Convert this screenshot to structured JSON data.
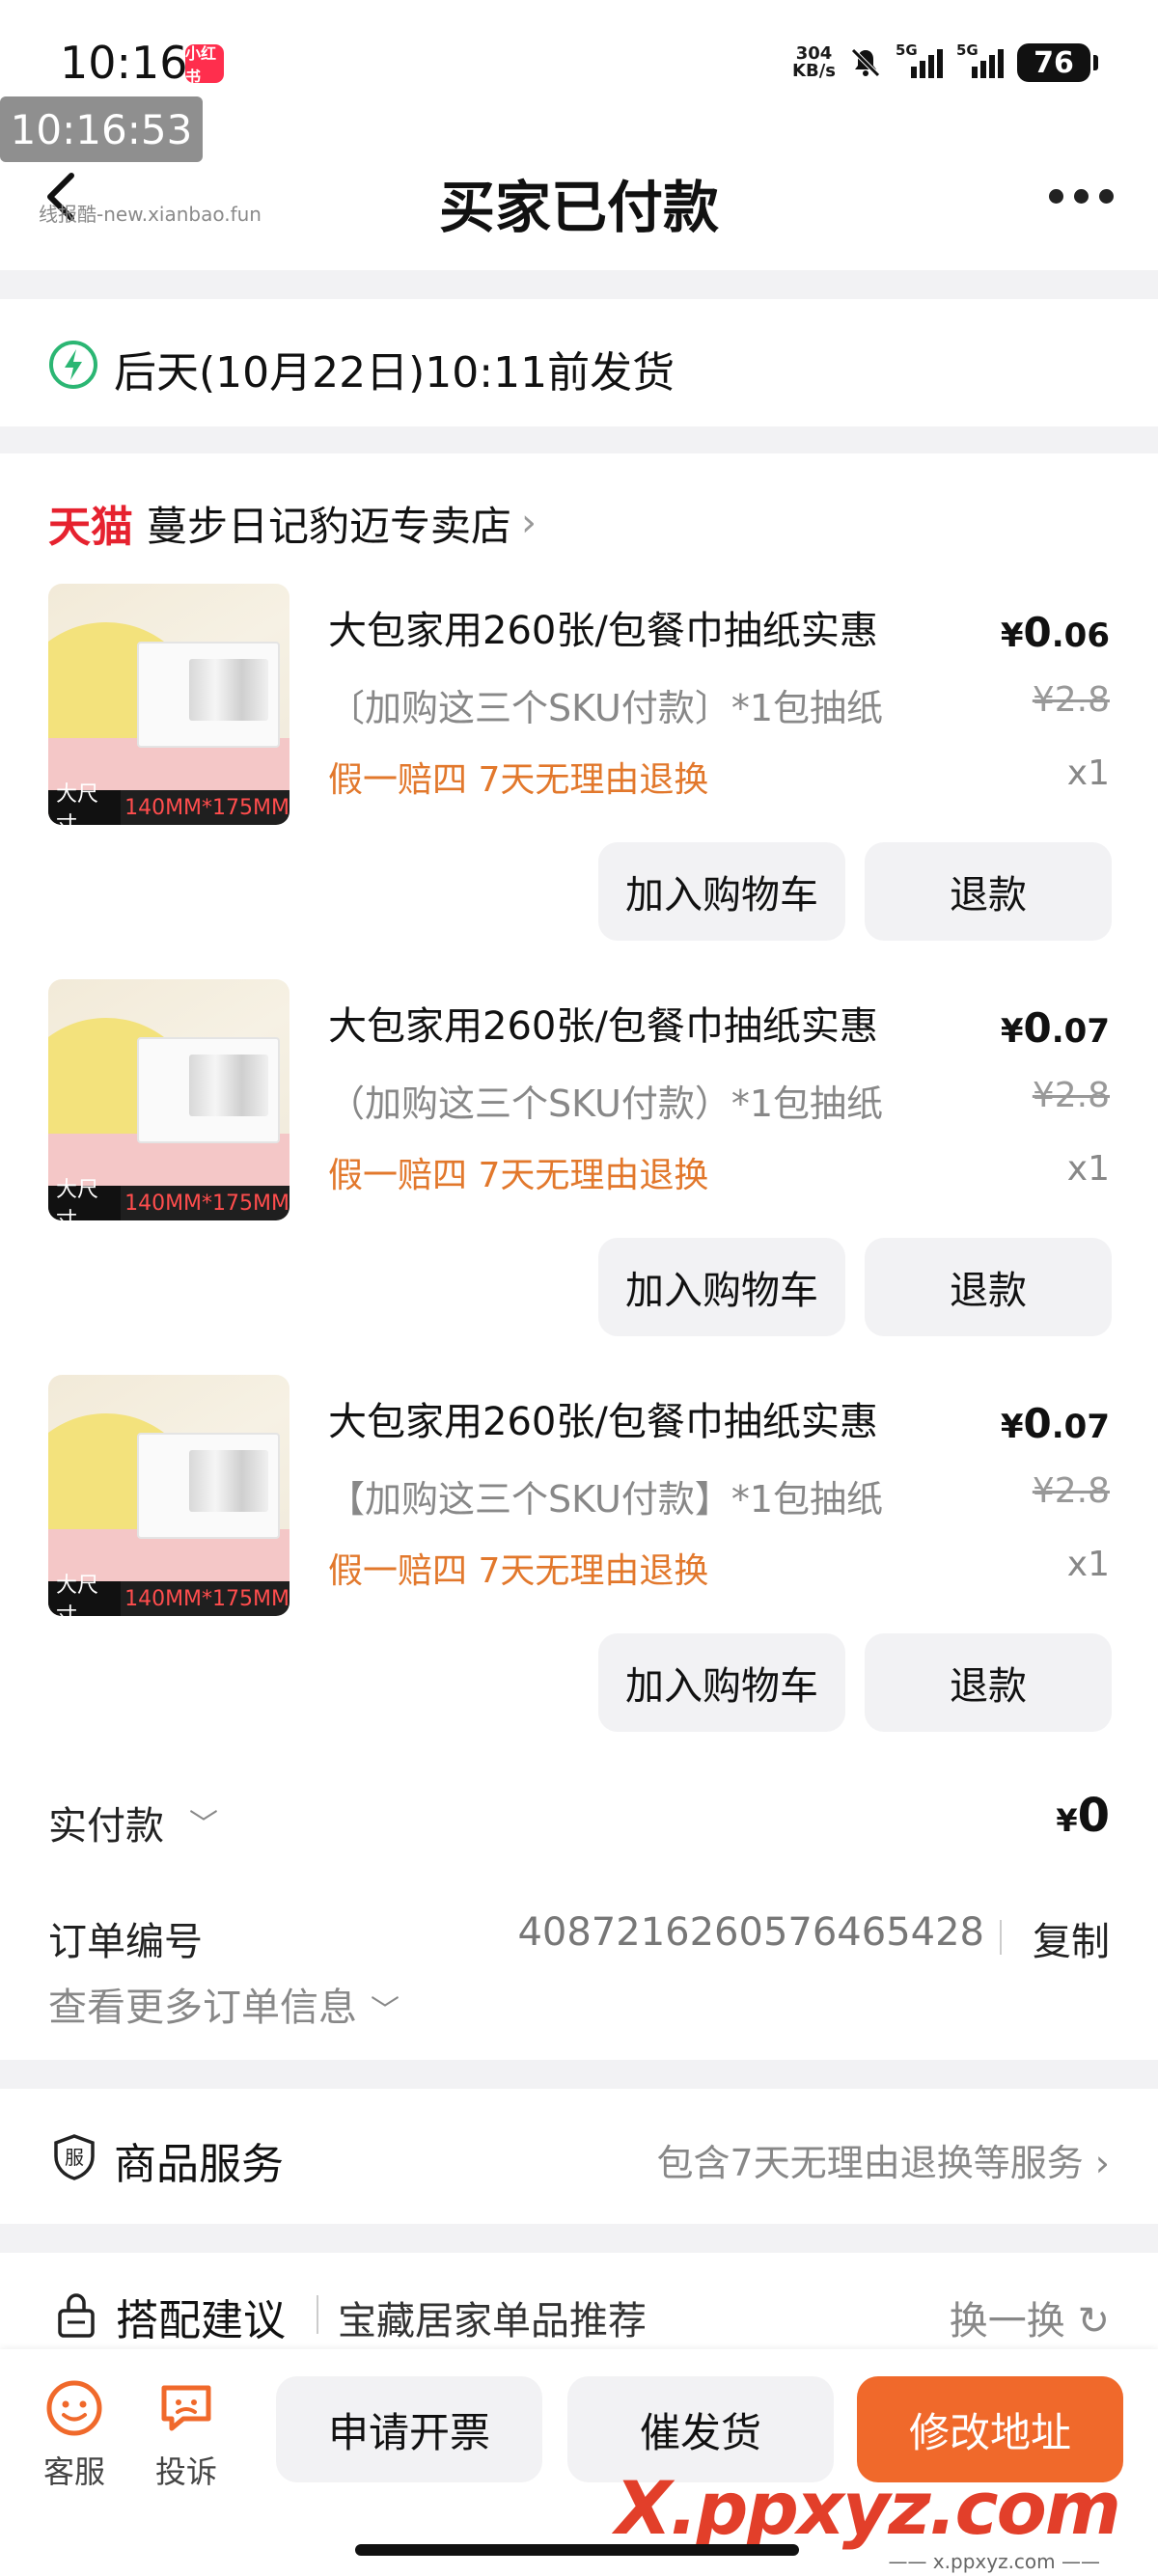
{
  "status_bar": {
    "time": "10:16",
    "app_badge": "小红书",
    "speed_value": "304",
    "speed_unit": "KB/s",
    "net1": "5G",
    "net2": "5G",
    "battery": "76"
  },
  "overlay_clock": "10:16:53",
  "header": {
    "title": "买家已付款",
    "watermark": "线报酷-new.xianbao.fun"
  },
  "ship_notice": {
    "text": "后天(10月22日)10:11前发货",
    "accent": "#2bb673"
  },
  "shop": {
    "platform": "天猫",
    "name": "蔓步日记豹迈专卖店"
  },
  "items": [
    {
      "thumb_badge_a": "大尺寸",
      "thumb_badge_b": "140MM*175MM",
      "title": "大包家用260张/包餐巾抽纸实惠",
      "sku": "〔加购这三个SKU付款〕*1包抽纸",
      "promo": "假一赔四  7天无理由退换",
      "price_sym": "¥",
      "price_int": "0",
      "price_dec": ".06",
      "orig_price": "¥2.8",
      "qty": "x1",
      "btn_cart": "加入购物车",
      "btn_refund": "退款"
    },
    {
      "thumb_badge_a": "大尺寸",
      "thumb_badge_b": "140MM*175MM",
      "title": "大包家用260张/包餐巾抽纸实惠",
      "sku": "（加购这三个SKU付款）*1包抽纸",
      "promo": "假一赔四  7天无理由退换",
      "price_sym": "¥",
      "price_int": "0",
      "price_dec": ".07",
      "orig_price": "¥2.8",
      "qty": "x1",
      "btn_cart": "加入购物车",
      "btn_refund": "退款"
    },
    {
      "thumb_badge_a": "大尺寸",
      "thumb_badge_b": "140MM*175MM",
      "title": "大包家用260张/包餐巾抽纸实惠",
      "sku": "【加购这三个SKU付款】*1包抽纸",
      "promo": "假一赔四  7天无理由退换",
      "price_sym": "¥",
      "price_int": "0",
      "price_dec": ".07",
      "orig_price": "¥2.8",
      "qty": "x1",
      "btn_cart": "加入购物车",
      "btn_refund": "退款"
    }
  ],
  "payment": {
    "label": "实付款",
    "sym": "¥",
    "amount": "0"
  },
  "order_info": {
    "label": "订单编号",
    "number": "4087216260576465428",
    "copy": "复制",
    "more": "查看更多订单信息"
  },
  "service": {
    "title": "商品服务",
    "desc": "包含7天无理由退换等服务"
  },
  "recommend": {
    "title": "搭配建议",
    "subtitle": "宝藏居家单品推荐",
    "swap": "换一换"
  },
  "bottom_bar": {
    "kefu": "客服",
    "tousu": "投诉",
    "invoice": "申请开票",
    "urge": "催发货",
    "address": "修改地址",
    "brand_color": "#f0692b"
  },
  "bottom_watermark": {
    "text": "X.ppxyz.com",
    "sub": "—— x.ppxyz.com ——"
  }
}
